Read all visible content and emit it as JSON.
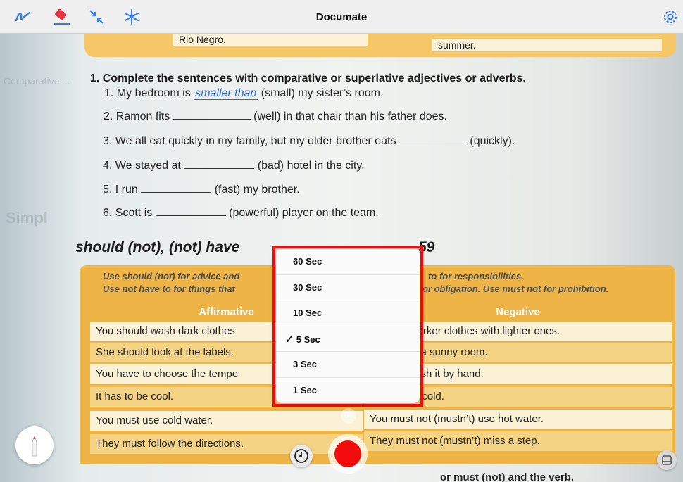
{
  "app": {
    "title": "Documate"
  },
  "toolbar": {
    "icons": [
      "pen-curve-icon",
      "eraser-icon",
      "collapse-arrows-icon",
      "snowflake-icon",
      "settings-gear-icon"
    ]
  },
  "page": {
    "summary": {
      "left": "Rio Negro.",
      "right": "summer."
    },
    "exercise_title": "1. Complete the sentences with comparative or superlative adjectives or adverbs.",
    "lines": [
      {
        "a": "1. My bedroom is",
        "answer": "smaller than",
        "b": "(small) my sister’s room."
      },
      {
        "a": "2. Ramon fits",
        "b": "(well) in that chair than his father does."
      },
      {
        "a": "3. We all eat quickly in my family, but my older brother eats",
        "b": "(quickly)."
      },
      {
        "a": "4. We stayed at",
        "b": "(bad) hotel in the city."
      },
      {
        "a": "5. I run",
        "b": "(fast) my brother."
      },
      {
        "a": "6. Scott is",
        "b": "(powerful) player on the team."
      }
    ],
    "section_heading": "should (not), (not) have",
    "section_heading_right": "59",
    "notes": {
      "l1": "Use should (not) for advice and",
      "l2": "Use not have to for things that",
      "r1": "to for responsibilities.",
      "r2": "or obligation. Use must not for prohibition."
    },
    "headers": {
      "affirmative": "Affirmative",
      "negative": "Negative"
    },
    "rows_left": [
      "You should wash dark clothes",
      "She should look at the labels.",
      "You have to choose the tempe",
      "It has to be cool.",
      "You must use cold water.",
      "They must follow the directions."
    ],
    "rows_right": [
      "n’t wash darker clothes with lighter ones.",
      "n’t put it in a sunny room.",
      "have to wash it by hand.",
      "have to be cold.",
      "You must not (mustn’t) use hot water.",
      "They must not (mustn’t) miss a step."
    ],
    "bottom_text": "or must (not) and the verb."
  },
  "menu": {
    "options": [
      "60 Sec",
      "30 Sec",
      "10 Sec",
      "5 Sec",
      "3 Sec",
      "1 Sec"
    ],
    "selected": "5 Sec",
    "check": "✓"
  },
  "controls": {
    "delay_badge": "5s",
    "colors": {
      "accent": "#2f7cf6",
      "shutter": "#f20c0c",
      "highlight": "#ff0a0a"
    }
  }
}
